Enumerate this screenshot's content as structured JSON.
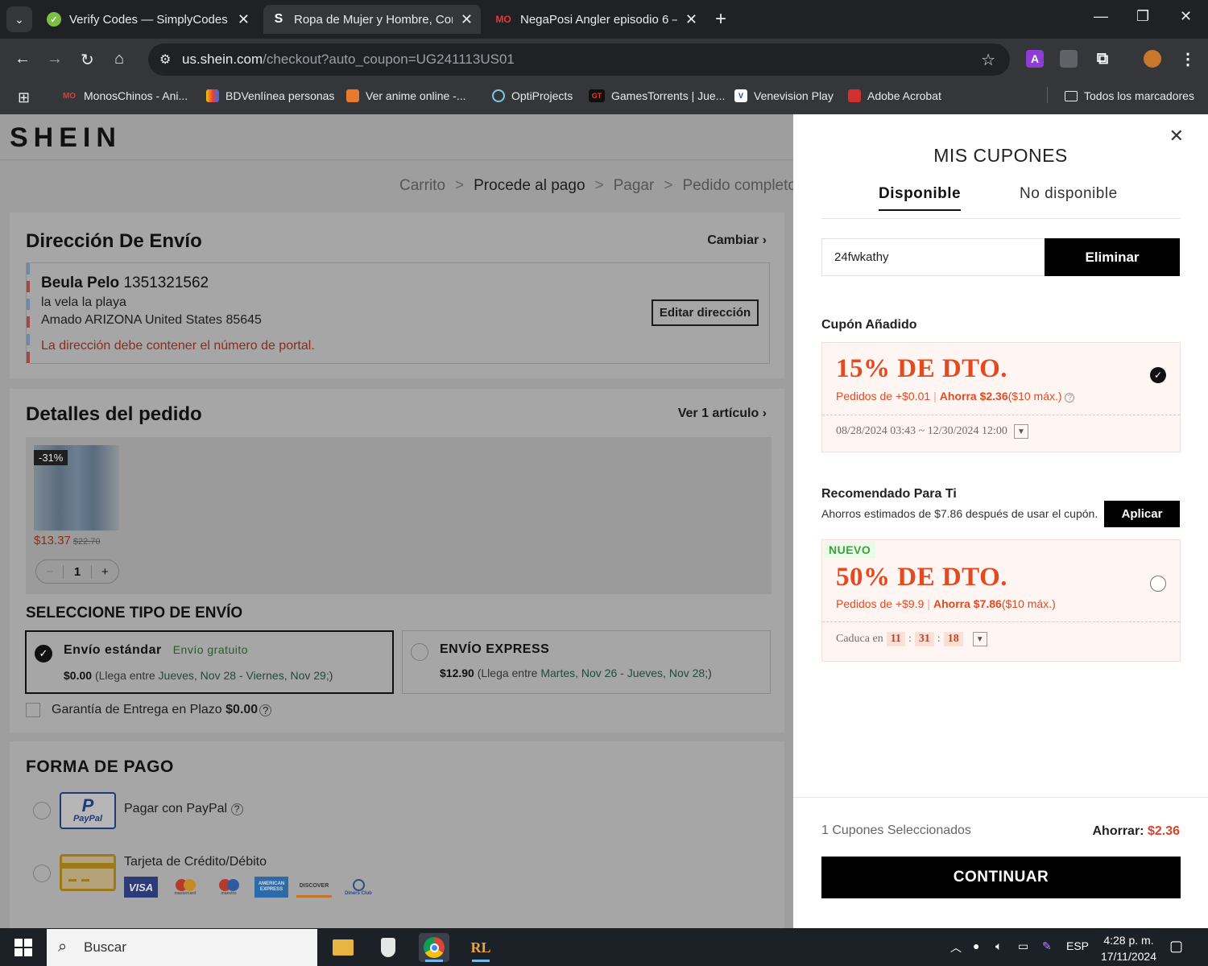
{
  "browser": {
    "tabs": [
      {
        "title": "Verify Codes — SimplyCodes",
        "favicon": "simplycodes-icon",
        "active": false
      },
      {
        "title": "Ropa de Mujer y Hombre, Comp",
        "favicon": "shein-s-icon",
        "active": true
      },
      {
        "title": "NegaPosi Angler episodio 6 — ",
        "favicon": "monoschinos-icon",
        "active": false
      }
    ],
    "url_host": "us.shein.com",
    "url_path": "/checkout?auto_coupon=UG241113US01",
    "bookmarks": [
      {
        "label": "MonosChinos - Ani...",
        "icon": "mo-icon"
      },
      {
        "label": "BDVenlínea personas",
        "icon": "bdv-icon"
      },
      {
        "label": "Ver anime online -...",
        "icon": "anime-icon"
      },
      {
        "label": "OptiProjects",
        "icon": "optiprojects-icon"
      },
      {
        "label": "GamesTorrents | Jue...",
        "icon": "gt-icon"
      },
      {
        "label": "Venevision Play",
        "icon": "venevision-icon"
      },
      {
        "label": "Adobe Acrobat",
        "icon": "acrobat-icon"
      }
    ],
    "all_bookmarks": "Todos los marcadores",
    "ext_a": "A"
  },
  "page": {
    "logo": "SHEIN",
    "breadcrumbs": [
      "Carrito",
      "Procede al pago",
      "Pagar",
      "Pedido completo"
    ],
    "crumb_sep": ">",
    "shipping_address": {
      "title": "Dirección De Envío",
      "change": "Cambiar",
      "name": "Beula Pelo",
      "phone": "1351321562",
      "line1": "la vela la playa",
      "line2": "Amado ARIZONA United States 85645",
      "warning": "La dirección debe contener el número de portal.",
      "edit_button": "Editar dirección"
    },
    "order": {
      "title": "Detalles del pedido",
      "view_items": "Ver 1 artículo",
      "discount_badge": "-31%",
      "price": "$13.37",
      "old_price": "$22.70",
      "qty_minus": "−",
      "qty": "1",
      "qty_plus": "+"
    },
    "shipping_type": {
      "title": "SELECCIONE TIPO DE ENVÍO",
      "standard": {
        "name": "Envío estándar",
        "tag": "Envío gratuito",
        "price": "$0.00",
        "desc_prefix": "(Llega entre ",
        "dates": "Jueves, Nov 28 - Viernes, Nov 29;",
        "desc_suffix": ")"
      },
      "express": {
        "name": "ENVÍO EXPRESS",
        "price": "$12.90",
        "desc_prefix": "(Llega entre ",
        "dates": "Martes, Nov 26 - Jueves, Nov 28;",
        "desc_suffix": ")"
      },
      "guarantee_label": "Garantía de Entrega en Plazo",
      "guarantee_price": "$0.00"
    },
    "payment": {
      "title": "FORMA DE PAGO",
      "paypal": "Pagar con PayPal",
      "paypal_logo_p": "P",
      "paypal_logo_text": "PayPal",
      "card": "Tarjeta de Crédito/Débito",
      "brands": [
        "VISA",
        "mastercard",
        "maestro",
        "AMERICAN EXPRESS",
        "DISCOVER",
        "Diners Club"
      ]
    }
  },
  "drawer": {
    "title": "MIS CUPONES",
    "tabs": [
      "Disponible",
      "No disponible"
    ],
    "code_value": "24fwkathy",
    "remove_button": "Eliminar",
    "added_title": "Cupón Añadido",
    "added_coupon": {
      "headline": "15% DE DTO.",
      "min": "Pedidos de +$0.01",
      "save": "Ahorra $2.36",
      "cap": "($10 máx.)",
      "dates": "08/28/2024 03:43 ~ 12/30/2024 12:00"
    },
    "recommended_title": "Recomendado Para Ti",
    "estimated": "Ahorros estimados de $7.86 después de usar el cupón.",
    "apply_button": "Aplicar",
    "recommended_coupon": {
      "tag": "NUEVO",
      "headline": "50% DE DTO.",
      "min": "Pedidos de +$9.9",
      "save": "Ahorra $7.86",
      "cap": "($10 máx.)",
      "expires_label": "Caduca en",
      "hh": "11",
      "mm": "31",
      "ss": "18"
    },
    "selected_count": "1 Cupones Seleccionados",
    "save_label": "Ahorrar:",
    "save_amount": "$2.36",
    "continue_button": "CONTINUAR"
  },
  "taskbar": {
    "search_placeholder": "Buscar",
    "language": "ESP",
    "time": "4:28 p. m.",
    "date": "17/11/2024"
  }
}
